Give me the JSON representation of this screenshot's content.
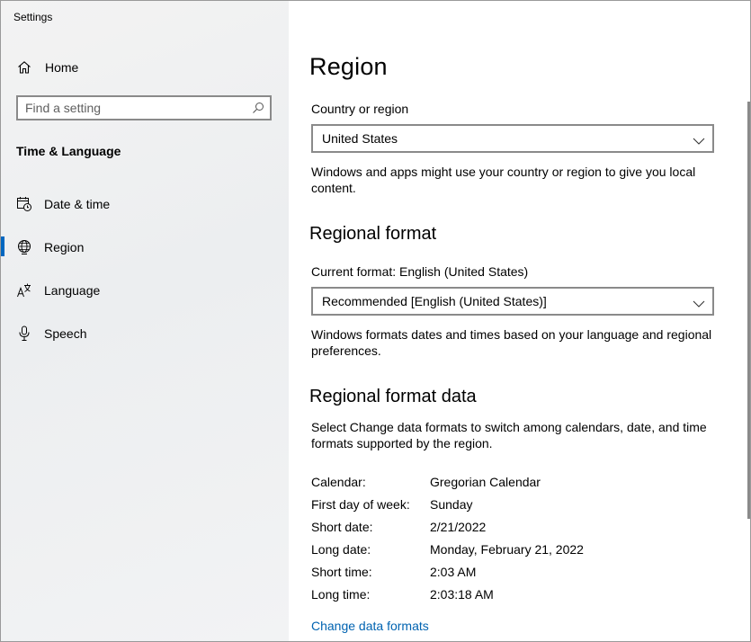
{
  "window": {
    "title": "Settings",
    "controls": {
      "minimize": "minimize-icon",
      "maximize": "maximize-icon",
      "close": "close-icon"
    }
  },
  "sidebar": {
    "home_label": "Home",
    "search_placeholder": "Find a setting",
    "section_heading": "Time & Language",
    "items": [
      {
        "label": "Date & time",
        "icon": "calendar-clock-icon"
      },
      {
        "label": "Region",
        "icon": "globe-icon",
        "selected": true
      },
      {
        "label": "Language",
        "icon": "language-icon"
      },
      {
        "label": "Speech",
        "icon": "microphone-icon"
      }
    ],
    "accent": "#0067c0"
  },
  "main": {
    "title": "Region",
    "country": {
      "label": "Country or region",
      "value": "United States",
      "description": "Windows and apps might use your country or region to give you local content."
    },
    "regional_format": {
      "heading": "Regional format",
      "label": "Current format: English (United States)",
      "value": "Recommended [English (United States)]",
      "description": "Windows formats dates and times based on your language and regional preferences."
    },
    "format_data": {
      "heading": "Regional format data",
      "description": "Select Change data formats to switch among calendars, date, and time formats supported by the region.",
      "rows": [
        {
          "key": "Calendar:",
          "value": "Gregorian Calendar"
        },
        {
          "key": "First day of week:",
          "value": "Sunday"
        },
        {
          "key": "Short date:",
          "value": "2/21/2022"
        },
        {
          "key": "Long date:",
          "value": "Monday, February 21, 2022"
        },
        {
          "key": "Short time:",
          "value": "2:03 AM"
        },
        {
          "key": "Long time:",
          "value": "2:03:18 AM"
        }
      ],
      "link": "Change data formats"
    },
    "link_color": "#0063b1"
  }
}
